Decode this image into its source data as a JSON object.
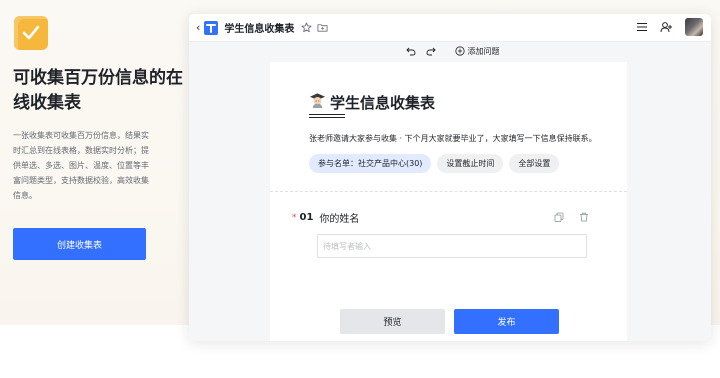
{
  "promo": {
    "title": "可收集百万份信息的在线收集表",
    "description": "一张收集表可收集百万份信息，结果实时汇总到在线表格，数据实时分析；提供单选、多选、图片、温度、位置等丰富问题类型，支持数据校验，高效收集信息。",
    "create_button": "创建收集表"
  },
  "window": {
    "doc_title": "学生信息收集表",
    "toolbar": {
      "add_question": "添加问题"
    },
    "form": {
      "title": "学生信息收集表",
      "description": "张老师邀请大家参与收集 · 下个月大家就要毕业了，大家填写一下信息保持联系。",
      "chips": [
        "参与名单：社交产品中心(30)",
        "设置截止时间",
        "全部设置"
      ],
      "question": {
        "required_mark": "*",
        "number": "01",
        "label": "你的姓名",
        "placeholder": "待填写者输入"
      },
      "preview_button": "预览",
      "publish_button": "发布"
    }
  },
  "colors": {
    "accent": "#3370ff",
    "logo": "#f5b73c",
    "required": "#f54a45"
  }
}
